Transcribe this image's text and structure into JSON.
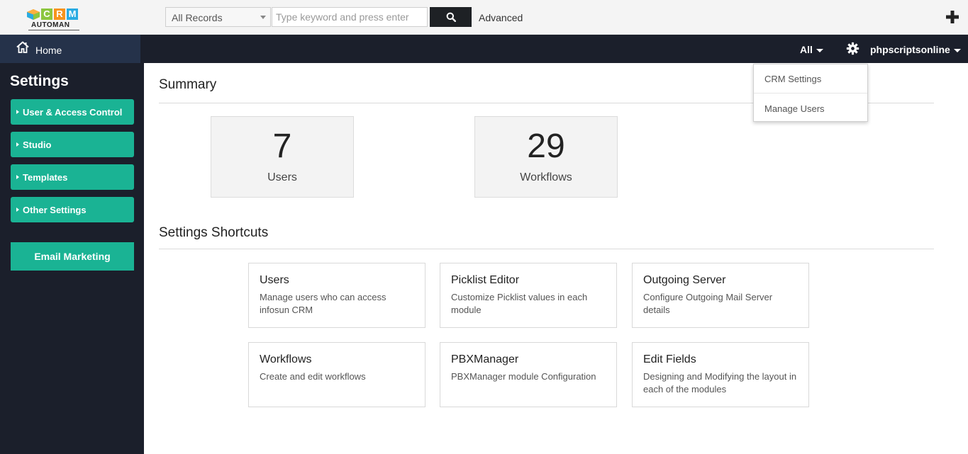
{
  "header": {
    "logo": {
      "letters": [
        "C",
        "R",
        "M"
      ],
      "letter_colors": [
        "#8cc63f",
        "#f7941d",
        "#29abe2"
      ],
      "subtitle": "AUTOMAN"
    },
    "search": {
      "scope": "All Records",
      "placeholder": "Type keyword and press enter",
      "value": ""
    },
    "advanced_label": "Advanced",
    "icons": {
      "search": "search-icon",
      "add": "plus-icon"
    }
  },
  "nav": {
    "home_label": "Home",
    "filter_label": "All",
    "user_label": "phpscriptsonline",
    "icons": {
      "home": "home-icon",
      "settings": "gear-icon"
    }
  },
  "settings_menu": {
    "items": [
      "CRM Settings",
      "Manage Users"
    ]
  },
  "sidebar": {
    "title": "Settings",
    "items": [
      "User & Access Control",
      "Studio",
      "Templates",
      "Other Settings"
    ],
    "email_marketing": "Email Marketing"
  },
  "main": {
    "summary_title": "Summary",
    "stats": [
      {
        "value": "7",
        "label": "Users"
      },
      {
        "value": "29",
        "label": "Workflows"
      }
    ],
    "shortcuts_title": "Settings Shortcuts",
    "shortcuts": [
      {
        "title": "Users",
        "desc": "Manage users who can access infosun CRM"
      },
      {
        "title": "Picklist Editor",
        "desc": "Customize Picklist values in each module"
      },
      {
        "title": "Outgoing Server",
        "desc": "Configure Outgoing Mail Server details"
      },
      {
        "title": "Workflows",
        "desc": "Create and edit workflows"
      },
      {
        "title": "PBXManager",
        "desc": "PBXManager module Configuration"
      },
      {
        "title": "Edit Fields",
        "desc": "Designing and Modifying the layout in each of the modules"
      }
    ]
  },
  "colors": {
    "accent": "#1ab394",
    "sidebar_bg": "#1b1f2b",
    "home_tab_bg": "#25324a"
  }
}
